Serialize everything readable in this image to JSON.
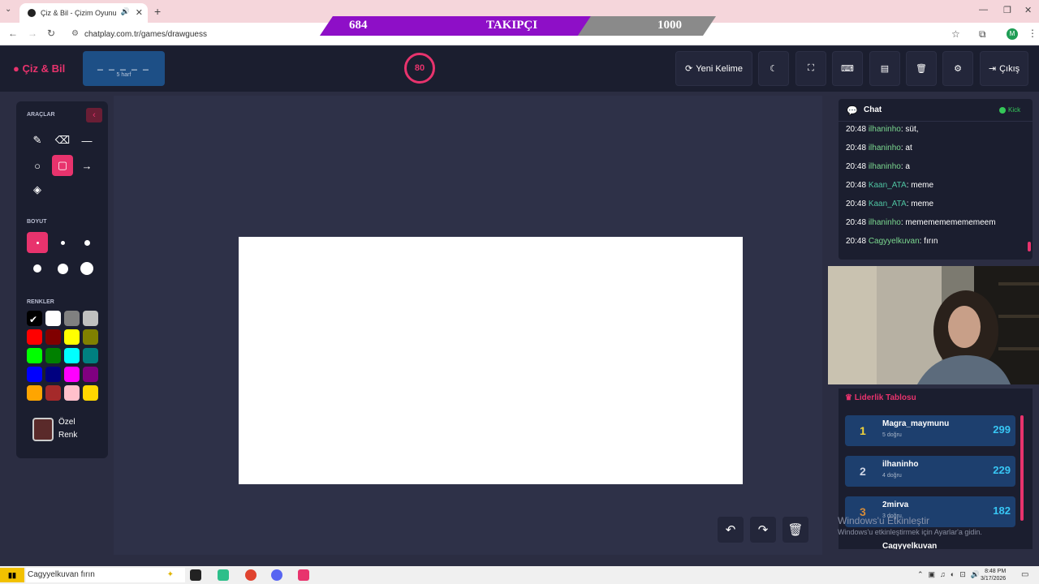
{
  "browser": {
    "tab_title": "Çiz & Bil - Çizim Oyunu",
    "url": "chatplay.com.tr/games/drawguess"
  },
  "follower_goal": {
    "current": "684",
    "label": "TAKIPÇI",
    "target": "1000",
    "progress": 0.684
  },
  "header": {
    "logo": "Çiz & Bil",
    "word_hint": "_ _ _ _ _",
    "word_length": "5 harf",
    "timer": "80",
    "new_word": "Yeni Kelime",
    "logout": "Çıkış"
  },
  "tools": {
    "section_tools": "ARAÇLAR",
    "section_size": "BOYUT",
    "section_colors": "RENKLER",
    "custom_color_1": "Özel",
    "custom_color_2": "Renk",
    "items": [
      "brush-icon",
      "eraser-icon",
      "line-icon",
      "circle-icon",
      "rectangle-icon",
      "arrow-icon",
      "fill-icon"
    ],
    "selected": "rectangle-icon",
    "colors": [
      "#000000",
      "#ffffff",
      "#808080",
      "#c0c0c0",
      "#ff0000",
      "#800000",
      "#ffff00",
      "#808000",
      "#00ff00",
      "#008000",
      "#00ffff",
      "#008080",
      "#0000ff",
      "#000080",
      "#ff00ff",
      "#800080",
      "#ffa500",
      "#a52a2a",
      "#ffc0cb",
      "#ffd700"
    ],
    "custom_swatch": "#5a2a2a"
  },
  "chat": {
    "title": "Chat",
    "status": "Kick",
    "messages": [
      {
        "time": "20:48",
        "user": "ilhaninho",
        "text": ": süt,"
      },
      {
        "time": "20:48",
        "user": "ilhaninho",
        "text": ": at"
      },
      {
        "time": "20:48",
        "user": "ilhaninho",
        "text": ": a"
      },
      {
        "time": "20:48",
        "user": "Kaan_ATA",
        "text": ": meme"
      },
      {
        "time": "20:48",
        "user": "Kaan_ATA",
        "text": ": meme"
      },
      {
        "time": "20:48",
        "user": "ilhaninho",
        "text": ": mememememememeem"
      },
      {
        "time": "20:48",
        "user": "Cagyyelkuvan",
        "text": ": fırın"
      }
    ]
  },
  "leaderboard": {
    "title": "Liderlik Tablosu",
    "rows": [
      {
        "rank": "1",
        "name": "Magra_maymunu",
        "sub": "5 doğru",
        "score": "299"
      },
      {
        "rank": "2",
        "name": "ilhaninho",
        "sub": "4 doğru",
        "score": "229"
      },
      {
        "rank": "3",
        "name": "2mirva",
        "sub": "3 doğru",
        "score": "182"
      }
    ],
    "next_partial": "Cagyyelkuvan"
  },
  "watermark": {
    "title": "Windows'u Etkinleştir",
    "sub": "Windows'u etkinleştirmek için Ayarlar'a gidin."
  },
  "taskbar": {
    "pinned_text": "Cagyyelkuvan fırın",
    "time": "8:48 PM",
    "date": "3/17/2026"
  }
}
